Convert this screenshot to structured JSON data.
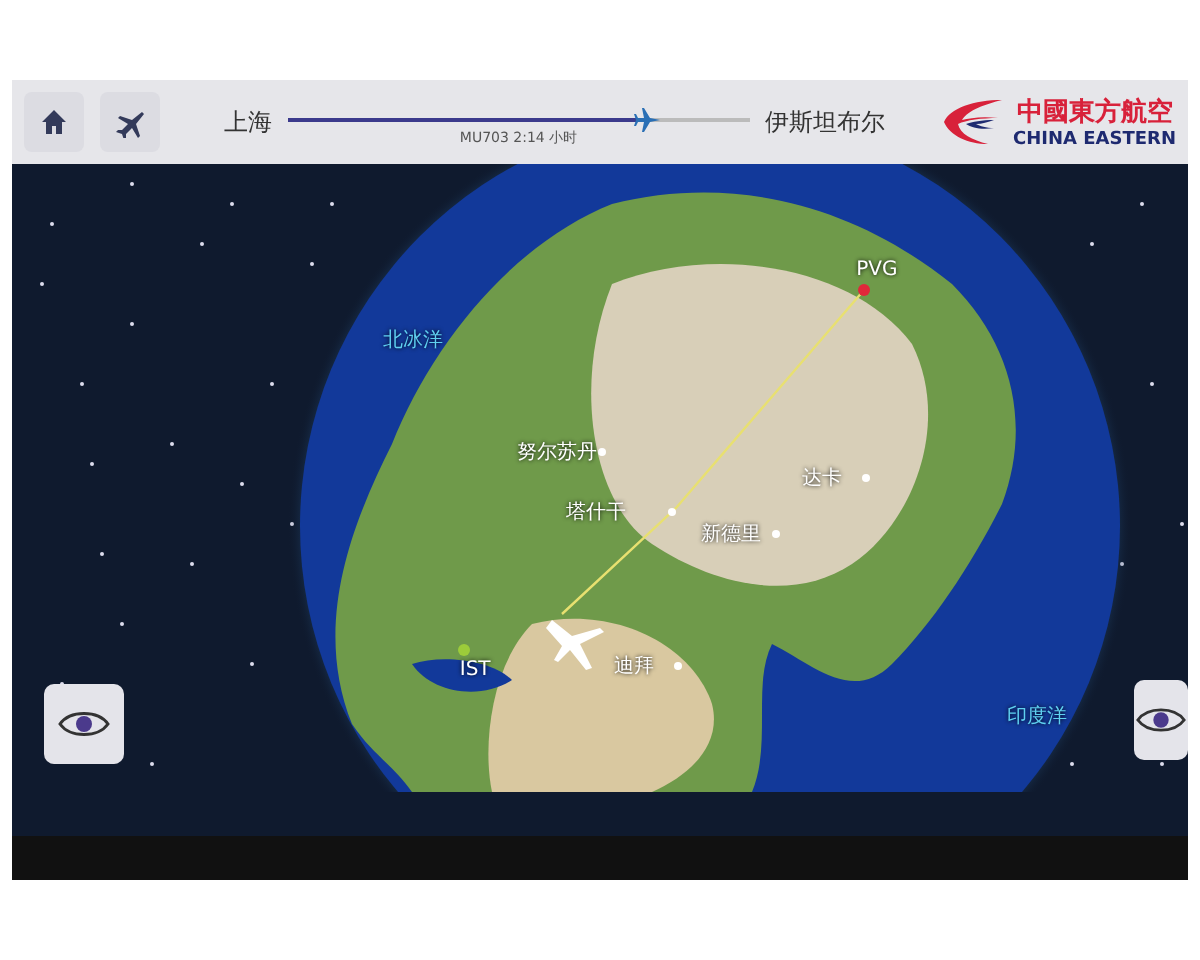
{
  "header": {
    "origin": "上海",
    "destination": "伊斯坦布尔",
    "flight_info": "MU703 2:14 小时",
    "progress": {
      "level": 0.78
    },
    "airline_name": "中國東方航空",
    "airline_name_en": "CHINA EASTERN"
  },
  "map": {
    "places": [
      {
        "kind": "airport",
        "label": "PVG",
        "color": "#e0283a"
      },
      {
        "kind": "airport",
        "label": "IST",
        "color": "#9ccc3a"
      },
      {
        "kind": "city",
        "label": "努尔苏丹"
      },
      {
        "kind": "city",
        "label": "塔什干"
      },
      {
        "kind": "city",
        "label": "新德里"
      },
      {
        "kind": "city",
        "label": "达卡"
      },
      {
        "kind": "city",
        "label": "迪拜"
      },
      {
        "kind": "ocean",
        "label": "北冰洋"
      },
      {
        "kind": "ocean",
        "label": "印度洋"
      }
    ]
  }
}
